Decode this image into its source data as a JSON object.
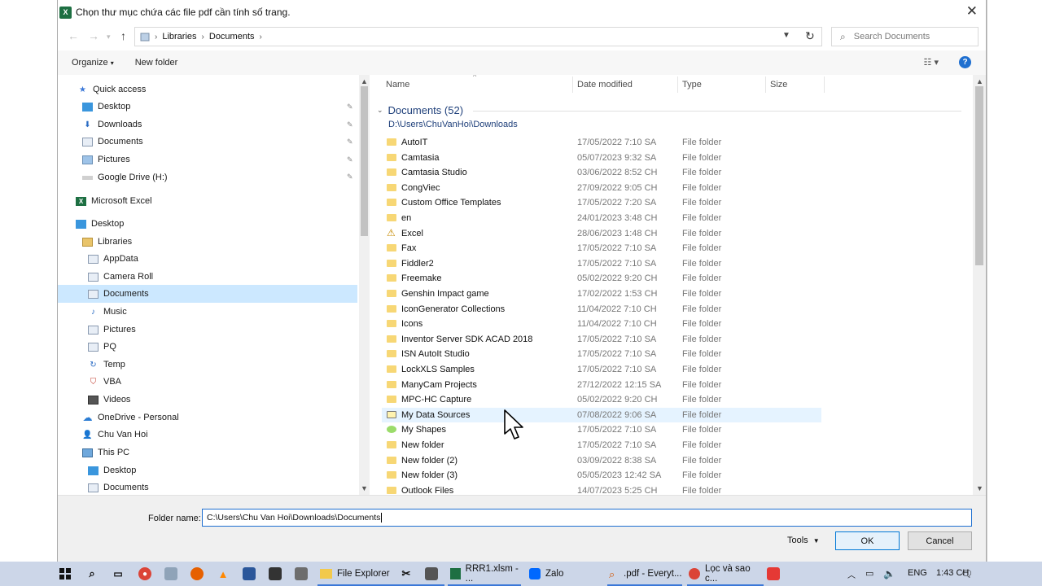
{
  "window": {
    "title": "Chọn thư mục chứa các file pdf cần tính số trang."
  },
  "address": {
    "segments": [
      "Libraries",
      "Documents"
    ],
    "search_placeholder": "Search Documents"
  },
  "toolbar": {
    "organize": "Organize",
    "new_folder": "New folder"
  },
  "nav": {
    "quick_access": "Quick access",
    "quick": [
      "Desktop",
      "Downloads",
      "Documents",
      "Pictures",
      "Google Drive (H:)"
    ],
    "excel": "Microsoft Excel",
    "desktop": "Desktop",
    "libraries": "Libraries",
    "lib_items": [
      "AppData",
      "Camera Roll",
      "Documents",
      "Music",
      "Pictures",
      "PQ",
      "Temp",
      "VBA",
      "Videos"
    ],
    "onedrive": "OneDrive - Personal",
    "user": "Chu Van Hoi",
    "this_pc": "This PC",
    "pc_items": [
      "Desktop",
      "Documents"
    ]
  },
  "columns": {
    "name": "Name",
    "date": "Date modified",
    "type": "Type",
    "size": "Size"
  },
  "group": {
    "title": "Documents (52)",
    "path": "D:\\Users\\ChuVanHoi\\Downloads"
  },
  "files": [
    {
      "name": "AutoIT",
      "date": "17/05/2022 7:10 SA",
      "type": "File folder"
    },
    {
      "name": "Camtasia",
      "date": "05/07/2023 9:32 SA",
      "type": "File folder"
    },
    {
      "name": "Camtasia Studio",
      "date": "03/06/2022 8:52 CH",
      "type": "File folder"
    },
    {
      "name": "CongViec",
      "date": "27/09/2022 9:05 CH",
      "type": "File folder"
    },
    {
      "name": "Custom Office Templates",
      "date": "17/05/2022 7:20 SA",
      "type": "File folder"
    },
    {
      "name": "en",
      "date": "24/01/2023 3:48 CH",
      "type": "File folder"
    },
    {
      "name": "Excel",
      "date": "28/06/2023 1:48 CH",
      "type": "File folder"
    },
    {
      "name": "Fax",
      "date": "17/05/2022 7:10 SA",
      "type": "File folder"
    },
    {
      "name": "Fiddler2",
      "date": "17/05/2022 7:10 SA",
      "type": "File folder"
    },
    {
      "name": "Freemake",
      "date": "05/02/2022 9:20 CH",
      "type": "File folder"
    },
    {
      "name": "Genshin Impact game",
      "date": "17/02/2022 1:53 CH",
      "type": "File folder"
    },
    {
      "name": "IconGenerator Collections",
      "date": "11/04/2022 7:10 CH",
      "type": "File folder"
    },
    {
      "name": "Icons",
      "date": "11/04/2022 7:10 CH",
      "type": "File folder"
    },
    {
      "name": "Inventor Server SDK ACAD 2018",
      "date": "17/05/2022 7:10 SA",
      "type": "File folder"
    },
    {
      "name": "ISN AutoIt Studio",
      "date": "17/05/2022 7:10 SA",
      "type": "File folder"
    },
    {
      "name": "LockXLS Samples",
      "date": "17/05/2022 7:10 SA",
      "type": "File folder"
    },
    {
      "name": "ManyCam Projects",
      "date": "27/12/2022 12:15 SA",
      "type": "File folder"
    },
    {
      "name": "MPC-HC Capture",
      "date": "05/02/2022 9:20 CH",
      "type": "File folder"
    },
    {
      "name": "My Data Sources",
      "date": "07/08/2022 9:06 SA",
      "type": "File folder"
    },
    {
      "name": "My Shapes",
      "date": "17/05/2022 7:10 SA",
      "type": "File folder"
    },
    {
      "name": "New folder",
      "date": "17/05/2022 7:10 SA",
      "type": "File folder"
    },
    {
      "name": "New folder (2)",
      "date": "03/09/2022 8:38 SA",
      "type": "File folder"
    },
    {
      "name": "New folder (3)",
      "date": "05/05/2023 12:42 SA",
      "type": "File folder"
    },
    {
      "name": "Outlook Files",
      "date": "14/07/2023 5:25 CH",
      "type": "File folder"
    }
  ],
  "footer": {
    "folder_label": "Folder name:",
    "folder_value": "C:\\Users\\Chu Van Hoi\\Downloads\\Documents",
    "tools": "Tools",
    "ok": "OK",
    "cancel": "Cancel"
  },
  "taskbar": {
    "apps": [
      "File Explorer",
      "RRR1.xlsm - ...",
      "Zalo",
      ".pdf - Everyt...",
      "Lọc và sao c..."
    ],
    "lang": "ENG",
    "time": "1:43 CH"
  }
}
